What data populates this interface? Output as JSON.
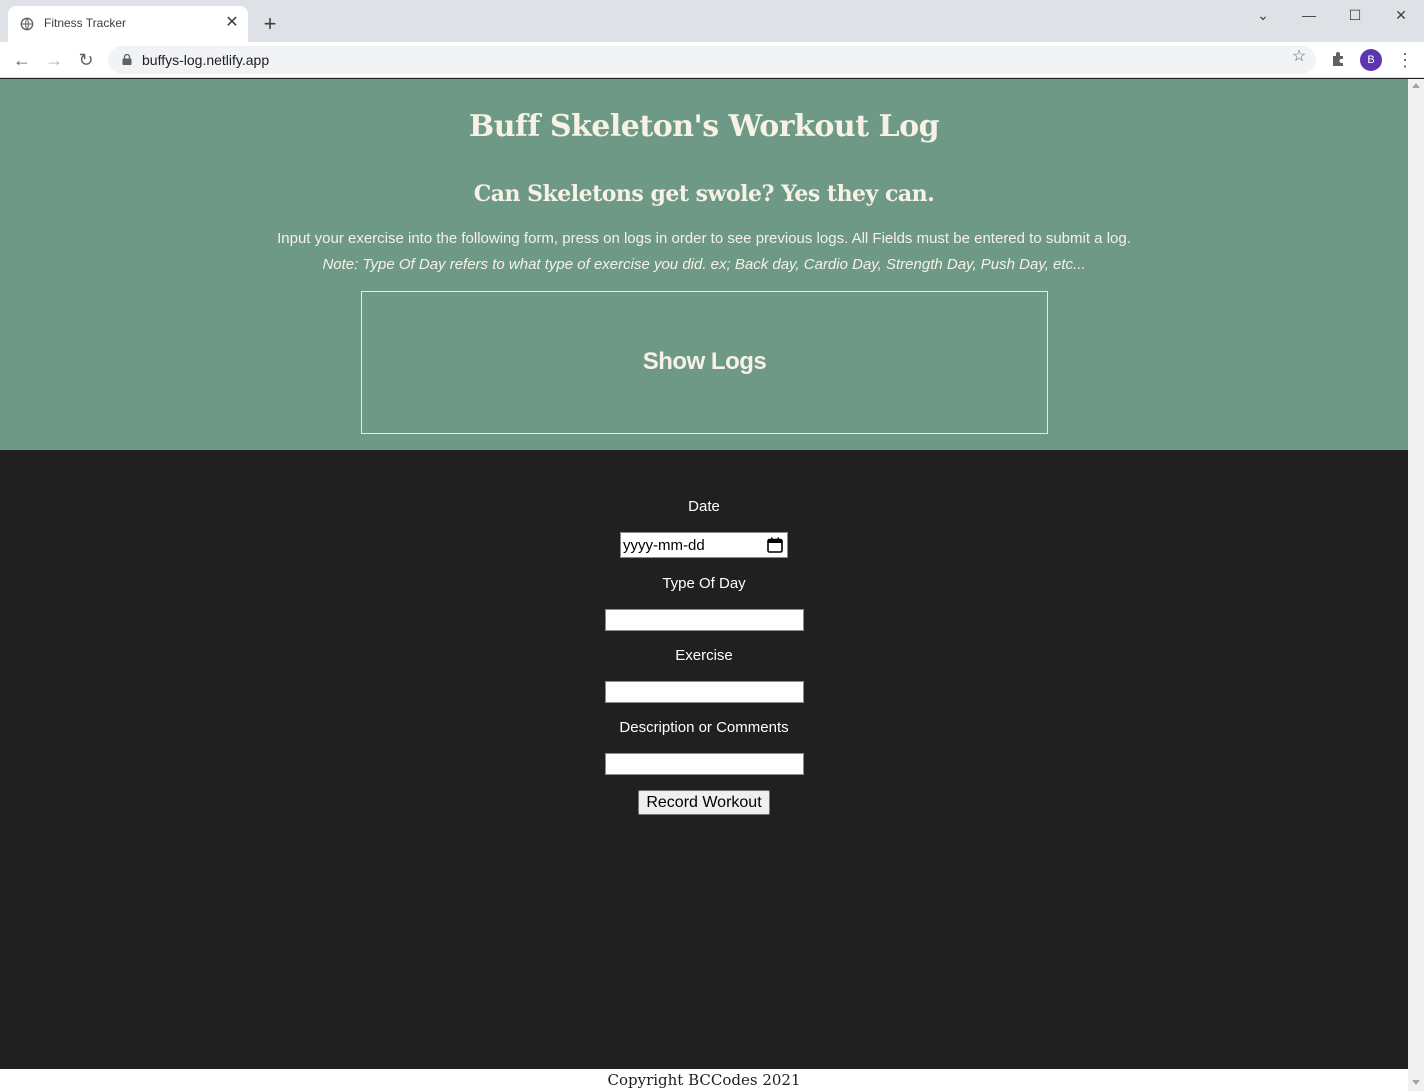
{
  "browser": {
    "tab_title": "Fitness Tracker",
    "url": "buffys-log.netlify.app",
    "profile_initial": "B",
    "new_tab_icon": "plus-icon",
    "close_icon": "close-icon"
  },
  "hero": {
    "title": "Buff Skeleton's Workout Log",
    "subtitle": "Can Skeletons get swole? Yes they can.",
    "intro": "Input your exercise into the following form, press on logs in order to see previous logs. All Fields must be entered to submit a log.",
    "note": "Note: Type Of Day refers to what type of exercise you did. ex; Back day, Cardio Day, Strength Day, Push Day, etc...",
    "show_logs_label": "Show Logs"
  },
  "form": {
    "date_label": "Date",
    "date_placeholder": "yyyy-mm-dd",
    "type_label": "Type Of Day",
    "type_value": "",
    "exercise_label": "Exercise",
    "exercise_value": "",
    "description_label": "Description or Comments",
    "description_value": "",
    "submit_label": "Record Workout"
  },
  "footer": {
    "copyright": "Copyright BCCodes 2021"
  },
  "colors": {
    "hero_bg": "#6e9987",
    "page_bg": "#202020",
    "text_cream": "#f7f1e6"
  }
}
